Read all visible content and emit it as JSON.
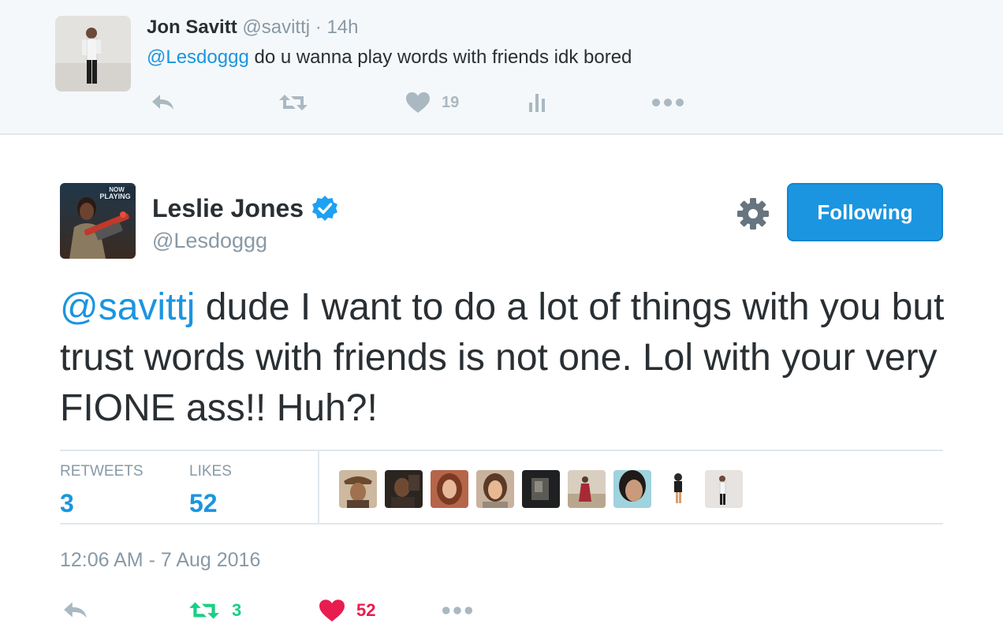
{
  "parent_tweet": {
    "author_name": "Jon Savitt",
    "author_handle": "@savittj",
    "separator": "·",
    "time": "14h",
    "mention": "@Lesdoggg",
    "text": " do u wanna play words with friends idk bored",
    "like_count": "19",
    "icons": [
      "reply-icon",
      "retweet-icon",
      "heart-icon",
      "analytics-icon",
      "more-icon"
    ]
  },
  "main_tweet": {
    "author_name": "Leslie Jones",
    "author_handle": "@Lesdoggg",
    "verified": true,
    "follow_button_label": "Following",
    "mention": "@savittj",
    "text": " dude I want to do a lot of things with you but trust words with friends is not one. Lol with your very FIONE ass!! Huh?!",
    "stats": {
      "retweets_label": "RETWEETS",
      "retweets_count": "3",
      "likes_label": "LIKES",
      "likes_count": "52"
    },
    "liker_avatar_count": 9,
    "timestamp": "12:06 AM - 7 Aug 2016",
    "actions": {
      "retweet_count": "3",
      "like_count": "52"
    }
  },
  "colors": {
    "link_blue": "#1b95e0",
    "muted_gray": "#8899a6",
    "retweet_green": "#19cf86",
    "like_red": "#e81c4f",
    "parent_background": "#f5f8fa",
    "verified_blue": "#1da1f2"
  }
}
